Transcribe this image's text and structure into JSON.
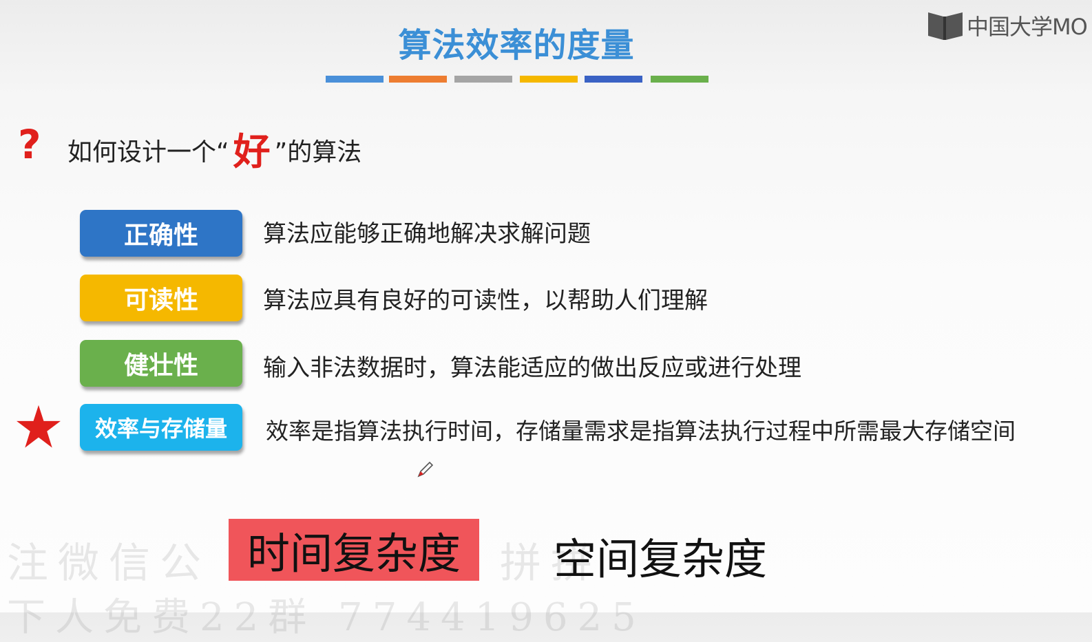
{
  "logo": {
    "text": "中国大学MO"
  },
  "title": "算法效率的度量",
  "color_bar": [
    "#4a90d9",
    "#ed7d31",
    "#a5a5a5",
    "#f5b800",
    "#3a62c4",
    "#6ab04c"
  ],
  "question": {
    "mark": "?",
    "before": "如何设计一个“",
    "highlight": "好",
    "after": "”的算法"
  },
  "criteria": [
    {
      "label": "正确性",
      "color": "#2e75c6",
      "description": "算法应能够正确地解决求解问题"
    },
    {
      "label": "可读性",
      "color": "#f5b800",
      "description": "算法应具有良好的可读性，以帮助人们理解"
    },
    {
      "label": "健壮性",
      "color": "#6ab04c",
      "description": "输入非法数据时，算法能适应的做出反应或进行处理"
    },
    {
      "label": "效率与存储量",
      "color": "#1cb3ec",
      "description": "效率是指算法执行时间，存储量需求是指算法执行过程中所需最大存储空间",
      "starred": true
    }
  ],
  "bottom": {
    "time_complexity": "时间复杂度",
    "space_complexity": "空间复杂度"
  },
  "watermark": {
    "line1": "注微信公",
    "line1_tail": "拼拼",
    "line2": "下人免费22群  774419625"
  }
}
